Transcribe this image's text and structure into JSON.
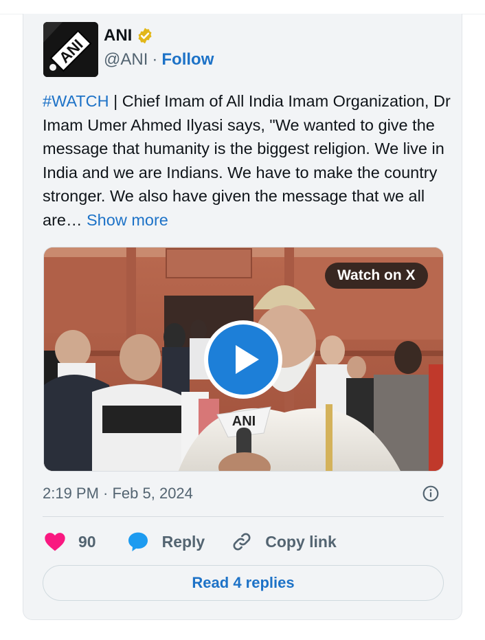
{
  "tweet": {
    "author_name": "ANI",
    "handle": "@ANI",
    "separator": "·",
    "follow_label": "Follow",
    "avatar_text": "ANI",
    "hashtag": "#WATCH",
    "body": " | Chief Imam of All India Imam Organization, Dr Imam Umer Ahmed Ilyasi says, \"We wanted to give the message that humanity is the biggest religion. We live in India and we are Indians. We have to make the country stronger. We also have given the message that we all are… ",
    "show_more_label": "Show more",
    "timestamp": "2:19 PM · Feb 5, 2024"
  },
  "media": {
    "watch_label": "Watch on X",
    "mic_brand": "ANI"
  },
  "actions": {
    "like_count": "90",
    "reply_label": "Reply",
    "copy_link_label": "Copy link",
    "read_replies_label": "Read 4 replies"
  },
  "colors": {
    "link_blue": "#1d72c7",
    "like_pink": "#f91880",
    "reply_blue": "#1d9bf0",
    "badge_gold": "#e2b719"
  },
  "icons": {
    "verified": "verified-badge-icon",
    "info": "info-icon",
    "like": "heart-icon",
    "reply": "speech-bubble-icon",
    "copy": "link-icon",
    "play": "play-icon"
  }
}
